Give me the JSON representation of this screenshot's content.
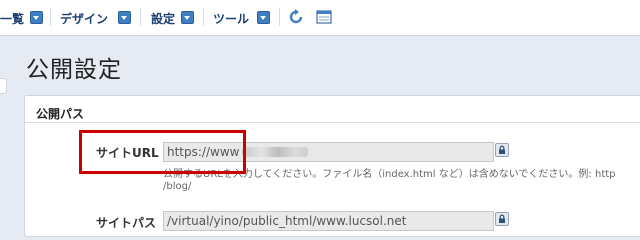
{
  "menubar": {
    "items": [
      {
        "label": "一覧"
      },
      {
        "label": "デザイン"
      },
      {
        "label": "設定"
      },
      {
        "label": "ツール"
      }
    ],
    "icons": [
      "refresh-icon",
      "window-icon"
    ]
  },
  "page": {
    "title": "公開設定"
  },
  "section": {
    "title": "公開パス"
  },
  "fields": {
    "site_url": {
      "label": "サイトURL",
      "value": "https://www",
      "help_line1": "公開するURLを入力してください。ファイル名（index.html など）は含めないでください。例: http",
      "help_line2": "/blog/"
    },
    "site_path": {
      "label": "サイトパス",
      "value": "/virtual/yino/public_html/www.lucsol.net"
    }
  },
  "colors": {
    "menu_text": "#1b3f72",
    "dropdown_button": "#3f7fc4",
    "highlight": "#cc0000",
    "background": "#e6ebf3"
  }
}
